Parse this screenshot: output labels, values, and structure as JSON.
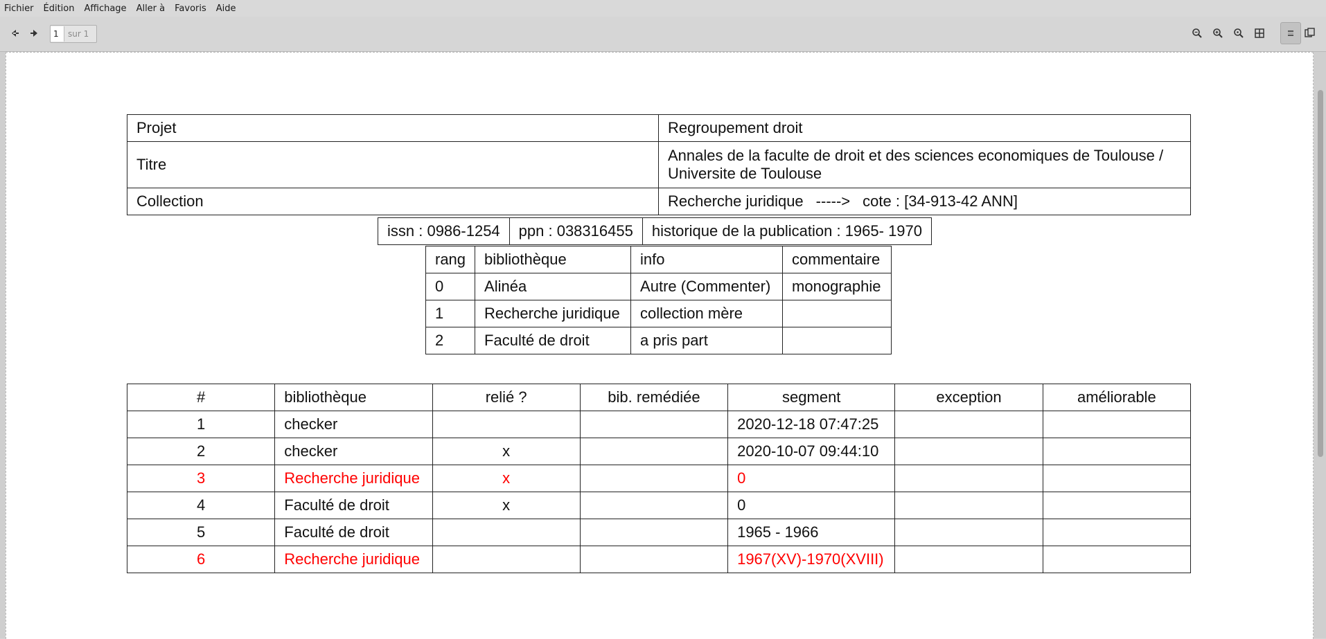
{
  "menubar": {
    "items": [
      "Fichier",
      "Édition",
      "Affichage",
      "Aller à",
      "Favoris",
      "Aide"
    ]
  },
  "toolbar": {
    "current_page": "1",
    "total_pages": "sur 1",
    "icons": [
      "arrow-left-icon",
      "arrow-right-icon",
      "zoom-fit-icon",
      "zoom-in-icon",
      "zoom-out-icon",
      "zoom-grid-icon",
      "continuous-mode-icon",
      "dual-page-icon"
    ]
  },
  "document": {
    "info": {
      "projet_label": "Projet",
      "projet_value": "Regroupement droit",
      "titre_label": "Titre",
      "titre_value_1": "Annales de la faculte de droit et des sciences economiques de Toulouse /",
      "titre_value_2": "Universite de Toulouse",
      "collection_label": "Collection",
      "collection_value": "Recherche juridique",
      "collection_arrow": "----->",
      "collection_cote": "cote : [34-913-42 ANN]"
    },
    "ids": {
      "issn": "issn : 0986-1254",
      "ppn": "ppn : 038316455",
      "historique": "historique de la publication : 1965- 1970"
    },
    "rank_table": {
      "headers": [
        "rang",
        "bibliothèque",
        "info",
        "commentaire"
      ],
      "rows": [
        [
          "0",
          "Alinéa",
          "Autre (Commenter)",
          "monographie"
        ],
        [
          "1",
          "Recherche juridique",
          "collection mère",
          ""
        ],
        [
          "2",
          "Faculté de droit",
          "a pris part",
          ""
        ]
      ]
    },
    "main_table": {
      "headers": [
        "#",
        "bibliothèque",
        "relié ?",
        "bib. remédiée",
        "segment",
        "exception",
        "améliorable"
      ],
      "rows": [
        [
          "1",
          "checker",
          "",
          "",
          "2020-12-18 07:47:25",
          "",
          ""
        ],
        [
          "2",
          "checker",
          "x",
          "",
          "2020-10-07 09:44:10",
          "",
          ""
        ],
        [
          "3",
          "Recherche juridique",
          "x",
          "",
          "0",
          "",
          ""
        ],
        [
          "4",
          "Faculté de droit",
          "x",
          "",
          "0",
          "",
          ""
        ],
        [
          "5",
          "Faculté de droit",
          "",
          "",
          "1965 - 1966",
          "",
          ""
        ],
        [
          "6",
          "Recherche juridique",
          "",
          "",
          "1967(XV)-1970(XVIII)",
          "",
          ""
        ]
      ],
      "highlight_color": "#ff0000"
    }
  }
}
